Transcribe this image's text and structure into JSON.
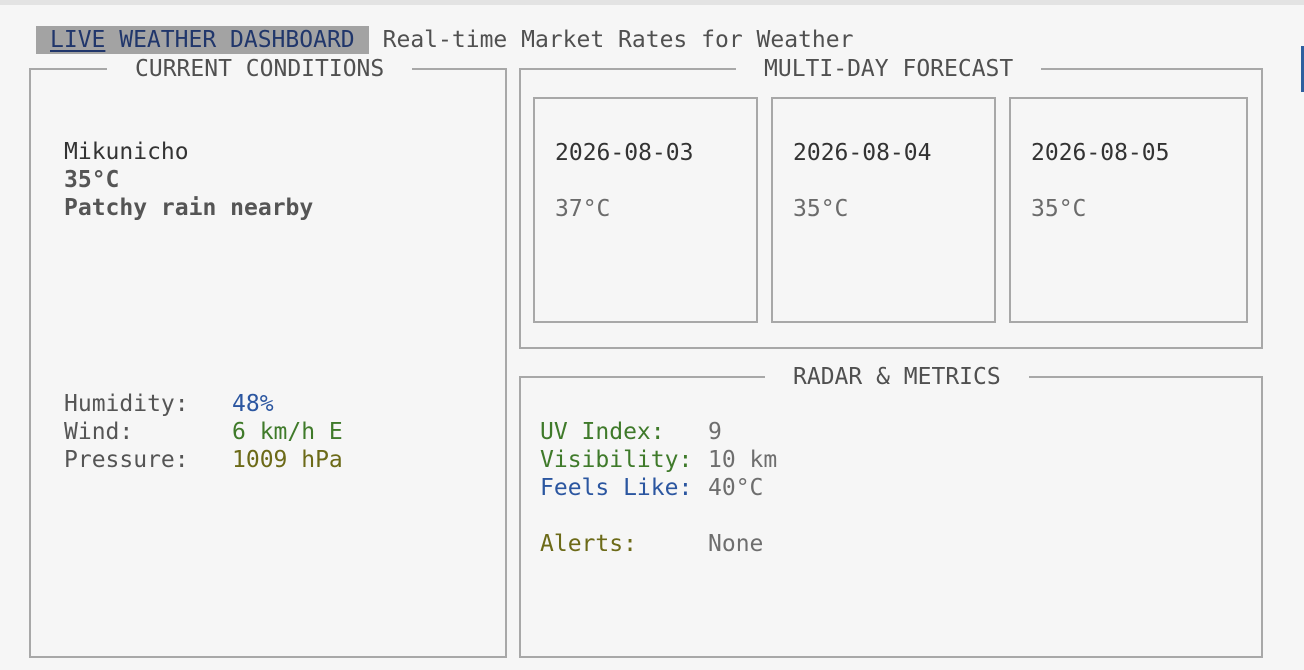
{
  "header": {
    "title_underlined": "LIVE",
    "title_rest": " WEATHER DASHBOARD",
    "subtitle": "Real-time Market Rates for Weather"
  },
  "current": {
    "heading": "CURRENT CONDITIONS",
    "location": "Mikunicho",
    "temperature": "35°C",
    "condition": "Patchy rain nearby",
    "metrics": [
      {
        "label": "Humidity:",
        "value": "48%"
      },
      {
        "label": "Wind:",
        "value": "6 km/h E"
      },
      {
        "label": "Pressure:",
        "value": "1009 hPa"
      }
    ]
  },
  "forecast": {
    "heading": "MULTI-DAY FORECAST",
    "days": [
      {
        "date": "2026-08-03",
        "temp": "37°C"
      },
      {
        "date": "2026-08-04",
        "temp": "35°C"
      },
      {
        "date": "2026-08-05",
        "temp": "35°C"
      }
    ]
  },
  "radar": {
    "heading": "RADAR & METRICS",
    "items": [
      {
        "label": "UV Index:",
        "value": "9"
      },
      {
        "label": "Visibility:",
        "value": "10 km"
      },
      {
        "label": "Feels Like:",
        "value": "40°C"
      }
    ],
    "alerts": {
      "label": "Alerts:",
      "value": "None"
    }
  },
  "colors": {
    "background": "#f6f6f6",
    "border": "#a8a8a8",
    "title_bg": "#a3a3a3",
    "title_text": "#20366b",
    "blue": "#2b56a0",
    "green": "#3f7a2a",
    "olive": "#6c6a18"
  }
}
